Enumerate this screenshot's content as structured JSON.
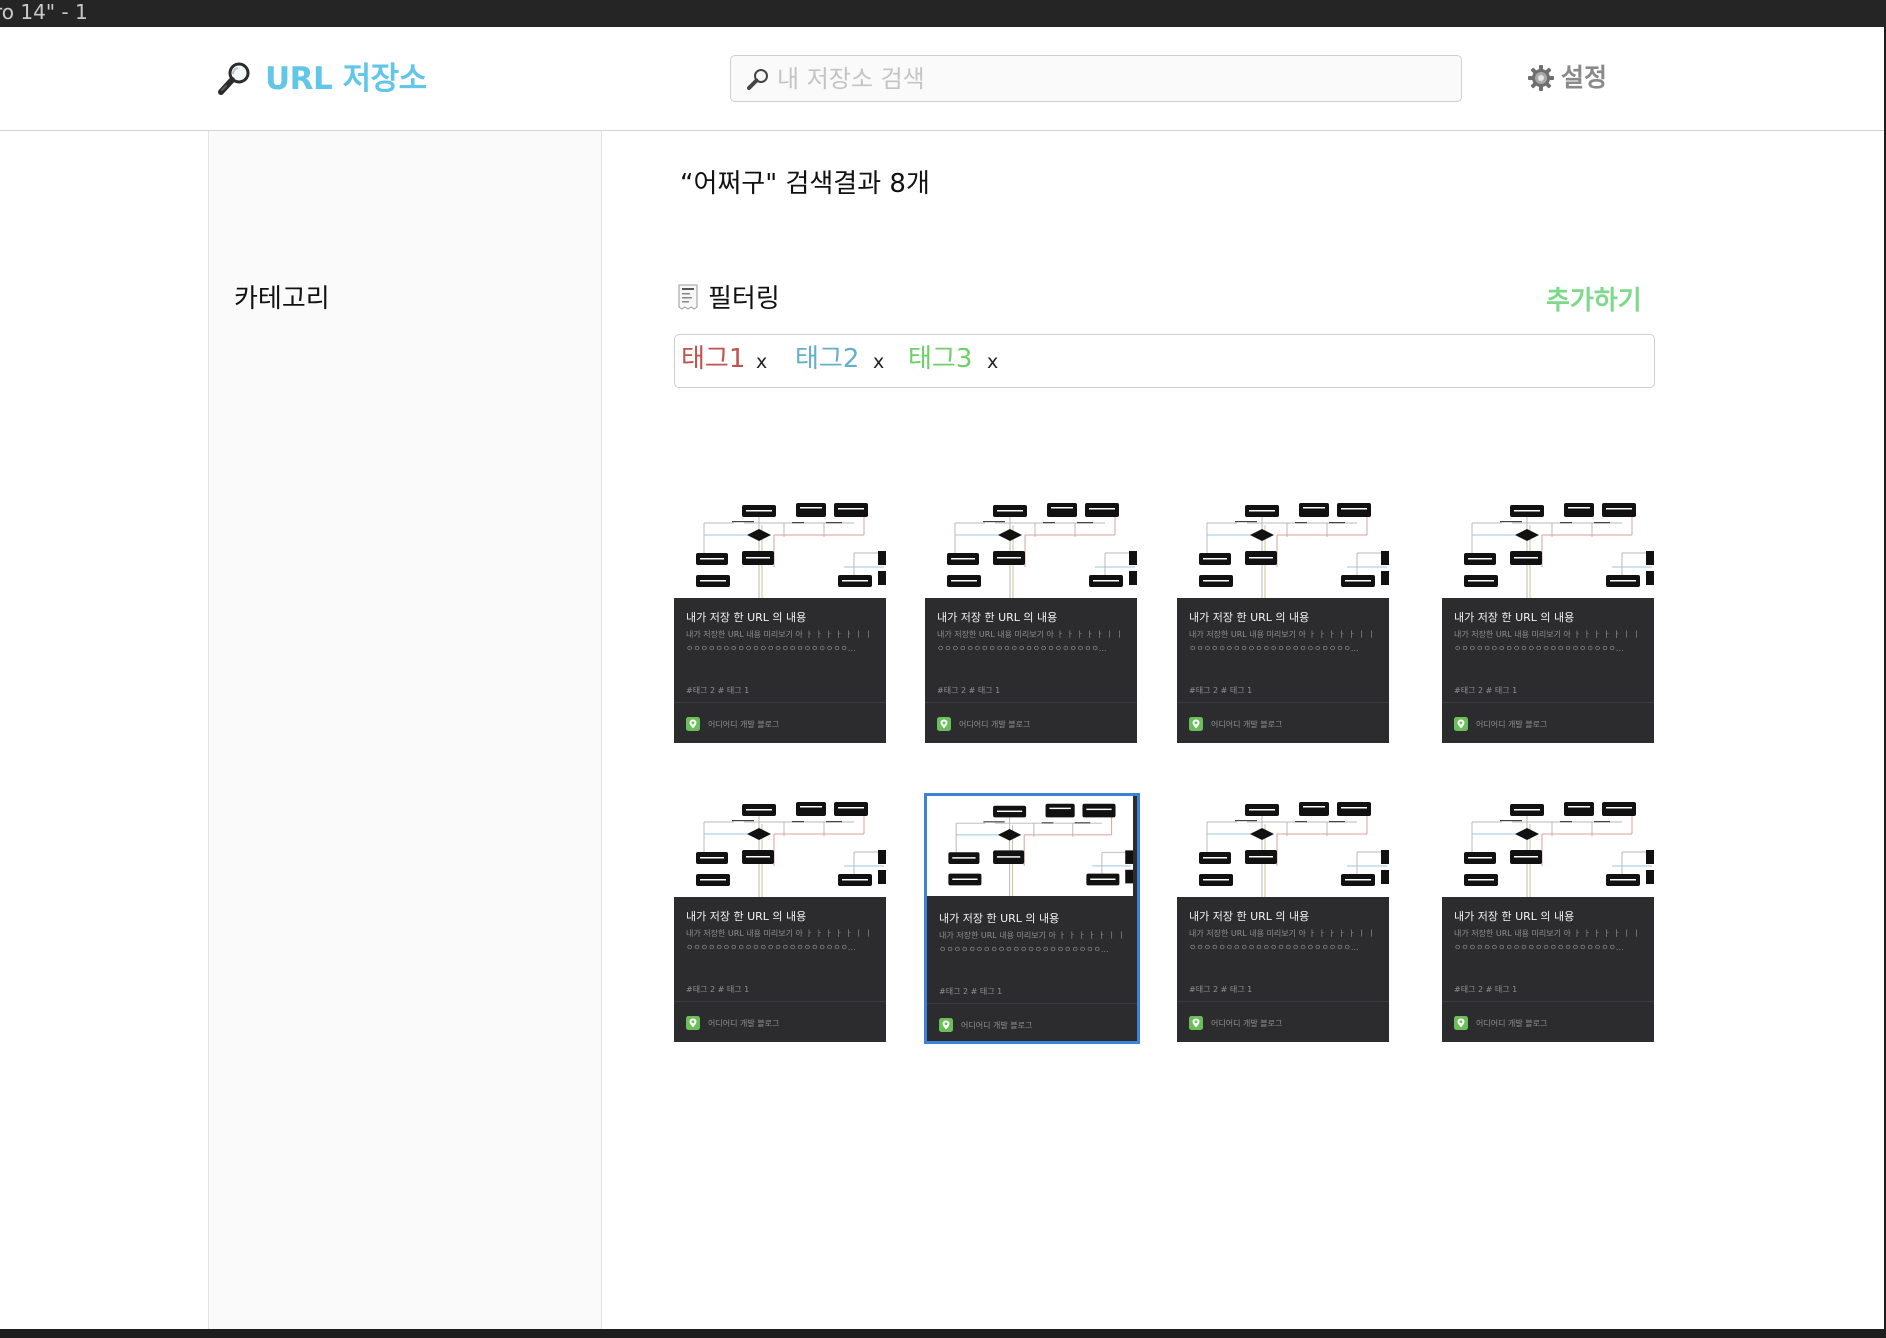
{
  "window": {
    "title": "ro 14\" - 1"
  },
  "header": {
    "logo_text": "URL 저장소",
    "search": {
      "placeholder": "내 저장소 검색",
      "value": ""
    },
    "settings_label": "설정"
  },
  "sidebar": {
    "title": "카테고리"
  },
  "main": {
    "result_title": "“어쩌구\" 검색결과 8개",
    "filter_label": "필터링",
    "add_label": "추가하기",
    "tags": [
      {
        "label": "태그1",
        "remove": "x",
        "color": "#c0534f"
      },
      {
        "label": "태그2",
        "remove": "x",
        "color": "#62b0cc"
      },
      {
        "label": "태그3",
        "remove": "x",
        "color": "#6cd067"
      }
    ],
    "cards": [
      {
        "title": "내가 저장 한 URL 의 내용",
        "desc1": "내가 저장한 URL 내용 미리보기 아 ㅏ ㅏ ㅏ ㅏ ㅏ ㅣ ㅣ",
        "desc2": "ㅇㅇㅇㅇㅇㅇㅇㅇㅇㅇㅇㅇㅇㅇㅇㅇㅇㅇㅇㅇㅇㅇ...",
        "tags": "#태그 2   # 태그 1",
        "source": "어디어디 개발 블로그",
        "selected": false
      },
      {
        "title": "내가 저장 한 URL 의 내용",
        "desc1": "내가 저장한 URL 내용 미리보기 아 ㅏ ㅏ ㅏ ㅏ ㅏ ㅣ ㅣ",
        "desc2": "ㅇㅇㅇㅇㅇㅇㅇㅇㅇㅇㅇㅇㅇㅇㅇㅇㅇㅇㅇㅇㅇㅇ...",
        "tags": "#태그 2   # 태그 1",
        "source": "어디어디 개발 블로그",
        "selected": false
      },
      {
        "title": "내가 저장 한 URL 의 내용",
        "desc1": "내가 저장한 URL 내용 미리보기 아 ㅏ ㅏ ㅏ ㅏ ㅏ ㅣ ㅣ",
        "desc2": "ㅇㅇㅇㅇㅇㅇㅇㅇㅇㅇㅇㅇㅇㅇㅇㅇㅇㅇㅇㅇㅇㅇ...",
        "tags": "#태그 2   # 태그 1",
        "source": "어디어디 개발 블로그",
        "selected": false
      },
      {
        "title": "내가 저장 한 URL 의 내용",
        "desc1": "내가 저장한 URL 내용 미리보기 아 ㅏ ㅏ ㅏ ㅏ ㅏ ㅣ ㅣ",
        "desc2": "ㅇㅇㅇㅇㅇㅇㅇㅇㅇㅇㅇㅇㅇㅇㅇㅇㅇㅇㅇㅇㅇㅇ...",
        "tags": "#태그 2   # 태그 1",
        "source": "어디어디 개발 블로그",
        "selected": false
      },
      {
        "title": "내가 저장 한 URL 의 내용",
        "desc1": "내가 저장한 URL 내용 미리보기 아 ㅏ ㅏ ㅏ ㅏ ㅏ ㅣ ㅣ",
        "desc2": "ㅇㅇㅇㅇㅇㅇㅇㅇㅇㅇㅇㅇㅇㅇㅇㅇㅇㅇㅇㅇㅇㅇ...",
        "tags": "#태그 2   # 태그 1",
        "source": "어디어디 개발 블로그",
        "selected": false
      },
      {
        "title": "내가 저장 한 URL 의 내용",
        "desc1": "내가 저장한 URL 내용 미리보기 아 ㅏ ㅏ ㅏ ㅏ ㅏ ㅣ ㅣ",
        "desc2": "ㅇㅇㅇㅇㅇㅇㅇㅇㅇㅇㅇㅇㅇㅇㅇㅇㅇㅇㅇㅇㅇㅇ...",
        "tags": "#태그 2   # 태그 1",
        "source": "어디어디 개발 블로그",
        "selected": true
      },
      {
        "title": "내가 저장 한 URL 의 내용",
        "desc1": "내가 저장한 URL 내용 미리보기 아 ㅏ ㅏ ㅏ ㅏ ㅏ ㅣ ㅣ",
        "desc2": "ㅇㅇㅇㅇㅇㅇㅇㅇㅇㅇㅇㅇㅇㅇㅇㅇㅇㅇㅇㅇㅇㅇ...",
        "tags": "#태그 2   # 태그 1",
        "source": "어디어디 개발 블로그",
        "selected": false
      },
      {
        "title": "내가 저장 한 URL 의 내용",
        "desc1": "내가 저장한 URL 내용 미리보기 아 ㅏ ㅏ ㅏ ㅏ ㅏ ㅣ ㅣ",
        "desc2": "ㅇㅇㅇㅇㅇㅇㅇㅇㅇㅇㅇㅇㅇㅇㅇㅇㅇㅇㅇㅇㅇㅇ...",
        "tags": "#태그 2   # 태그 1",
        "source": "어디어디 개발 블로그",
        "selected": false
      }
    ]
  },
  "icons": {
    "logo": "magnifier-icon",
    "search": "magnifier-icon",
    "settings": "gear-icon",
    "filter": "receipt-icon",
    "card_source": "map-pin-icon"
  },
  "colors": {
    "brand": "#62c6e8",
    "add": "#7ed98a",
    "card_bg": "#2c2c2f",
    "selected_border": "#3d82d6",
    "source_icon": "#6bbf59"
  }
}
